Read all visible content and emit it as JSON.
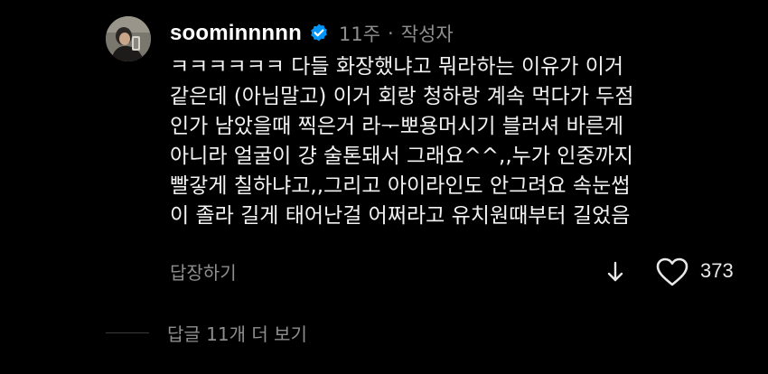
{
  "comment": {
    "username": "soominnnnn",
    "verified": true,
    "time": "11주",
    "separator": "·",
    "author_tag": "작성자",
    "body_lines": [
      "ㅋㅋㅋㅋㅋㅋ 다들 화장했냐고 뭐라하는 이유가 이거",
      "같은데 (아님말고) 이거 회랑 청하랑 계속 먹다가 두점",
      "인가 남았을때 찍은거 라ᅮ뽀용머시기 블러셔 바른게",
      "아니라 얼굴이 걍 술톤돼서 그래요^^,,누가 인중까지",
      "빨갛게 칠하냐고,,그리고 아이라인도 안그려요 속눈썹",
      "이 졸라 길게 태어난걸 어쩌라고 유치원때부터 길었음"
    ],
    "reply_label": "답장하기",
    "like_count": "373"
  },
  "more_replies": {
    "label": "답글 11개 더 보기"
  },
  "icons": {
    "verified": "verified-badge-icon",
    "down": "arrow-down-icon",
    "like": "heart-icon"
  },
  "colors": {
    "background": "#000000",
    "text": "#f2f2f2",
    "muted": "#8e8e8e",
    "verified": "#0095f6"
  }
}
